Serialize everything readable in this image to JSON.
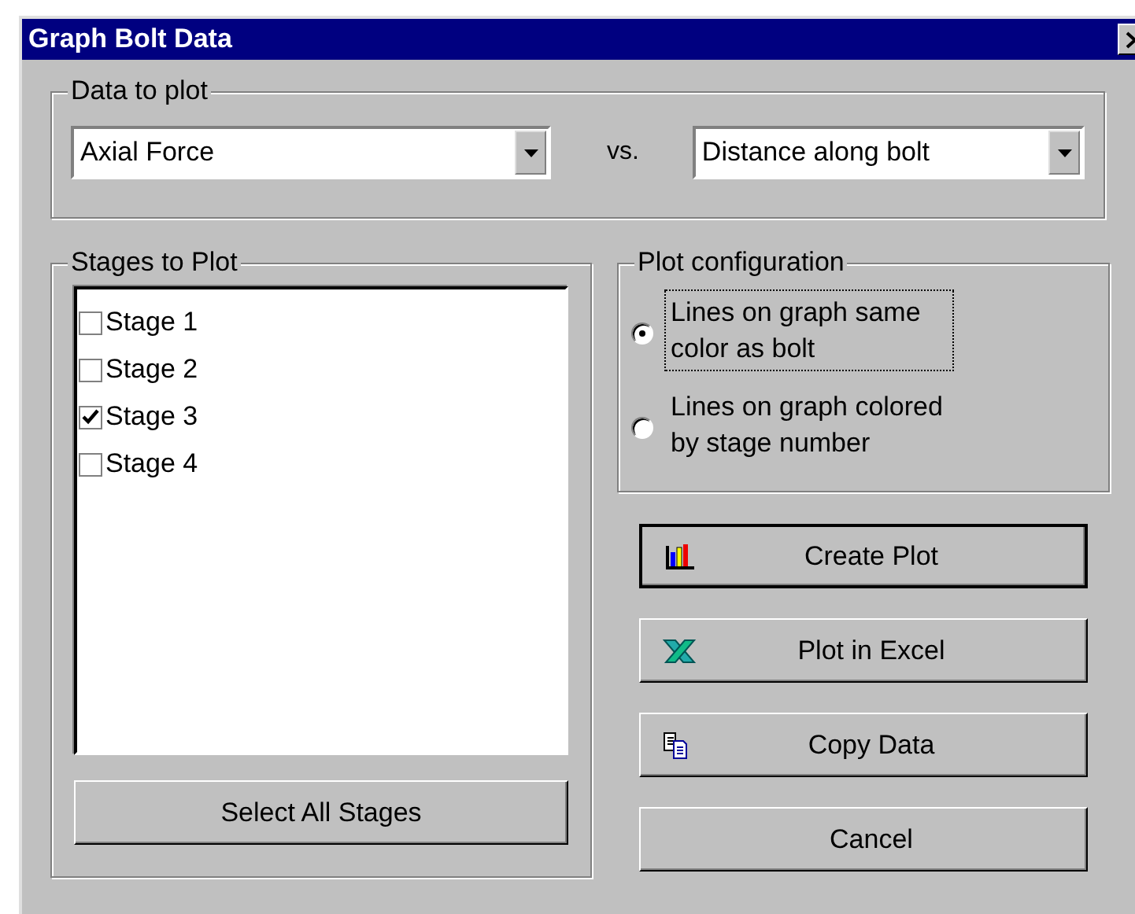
{
  "window": {
    "title": "Graph Bolt Data"
  },
  "data_to_plot": {
    "title": "Data to plot",
    "y_value": "Axial Force",
    "separator": "vs.",
    "x_value": "Distance along bolt"
  },
  "stages": {
    "title": "Stages to Plot",
    "items": [
      {
        "label": "Stage 1",
        "checked": false
      },
      {
        "label": "Stage 2",
        "checked": false
      },
      {
        "label": "Stage 3",
        "checked": true
      },
      {
        "label": "Stage 4",
        "checked": false
      }
    ],
    "select_all": "Select All Stages"
  },
  "plot_configuration": {
    "title": "Plot configuration",
    "options": [
      {
        "label": "Lines on graph same color as bolt",
        "selected": true,
        "focused": true
      },
      {
        "label": "Lines on graph colored by stage number",
        "selected": false,
        "focused": false
      }
    ]
  },
  "buttons": [
    {
      "label": "Create Plot",
      "kind": "chart",
      "default": true
    },
    {
      "label": "Plot in Excel",
      "kind": "excel",
      "default": false
    },
    {
      "label": "Copy Data",
      "kind": "copy",
      "default": false
    },
    {
      "label": "Cancel",
      "kind": "plain",
      "default": false
    }
  ]
}
